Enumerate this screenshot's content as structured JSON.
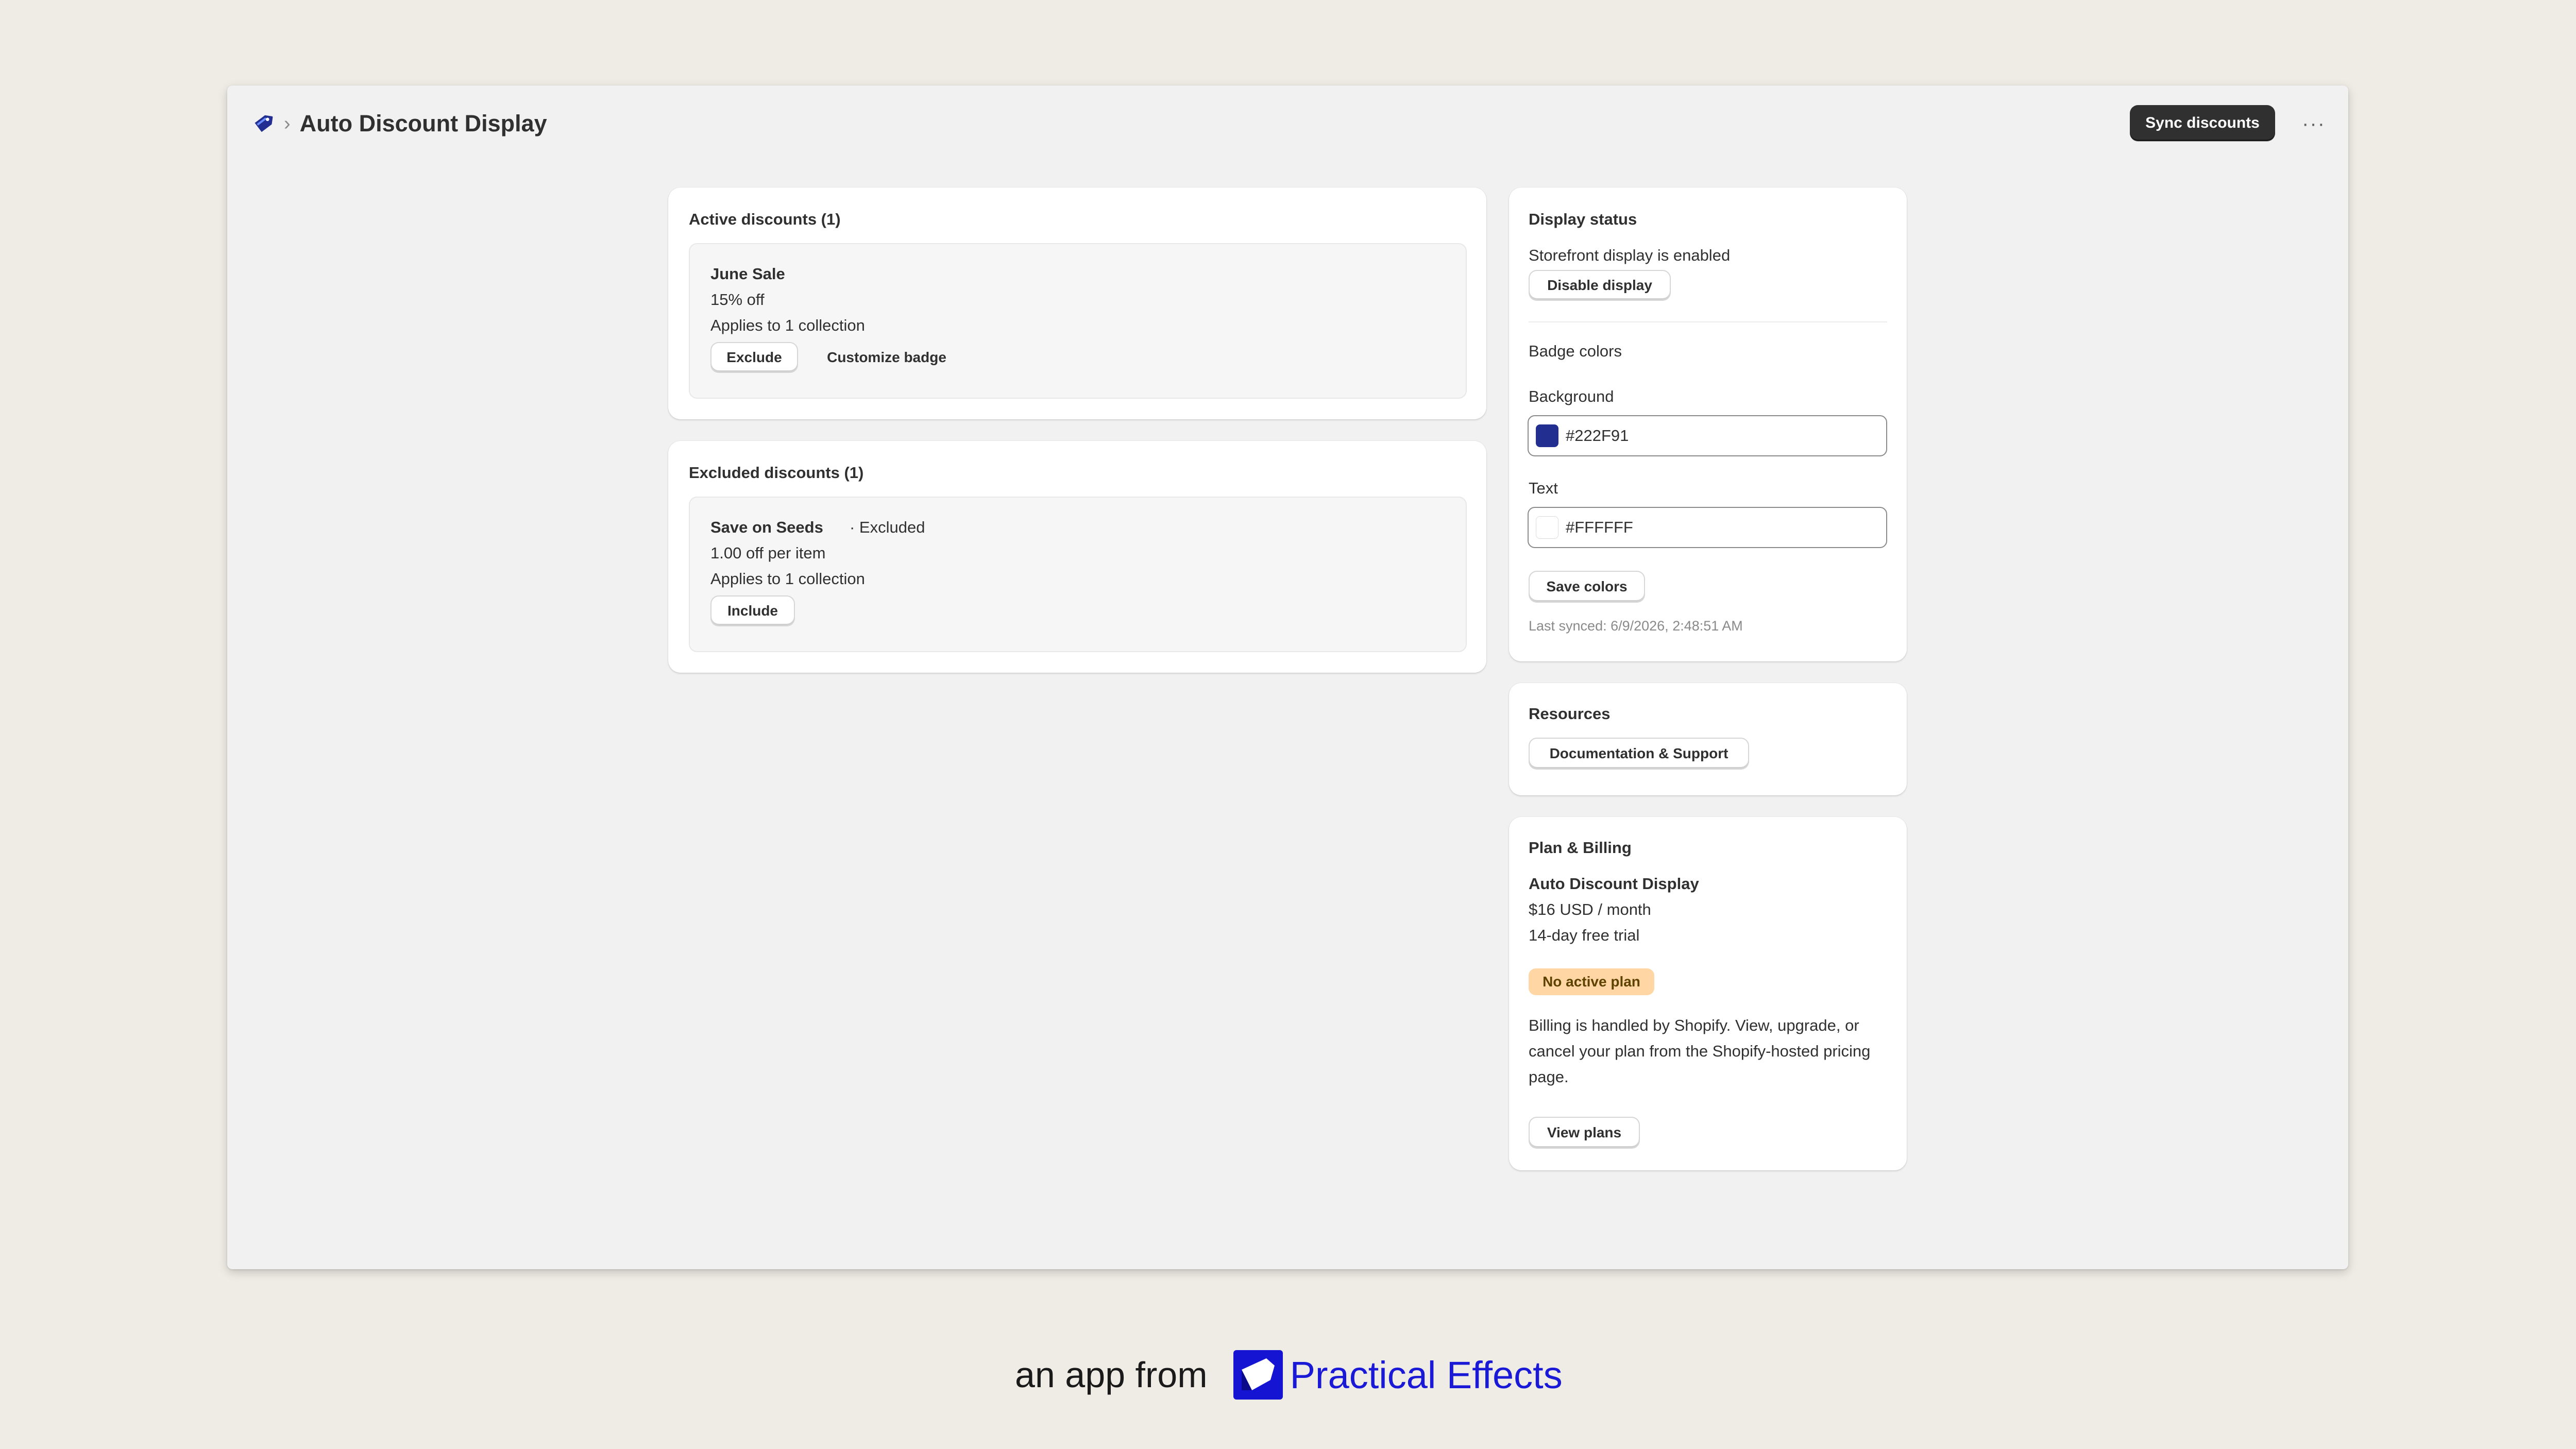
{
  "header": {
    "app_icon": "tag-icon",
    "title": "Auto Discount Display",
    "sync_label": "Sync discounts",
    "more_icon": "more-horizontal-icon"
  },
  "active_discounts": {
    "title": "Active discounts (1)",
    "items": [
      {
        "name": "June Sale",
        "value": "15% off",
        "applies": "Applies to 1 collection",
        "exclude_label": "Exclude",
        "customize_label": "Customize badge"
      }
    ]
  },
  "excluded_discounts": {
    "title": "Excluded discounts (1)",
    "items": [
      {
        "name": "Save on Seeds",
        "status": "· Excluded",
        "value": "1.00 off per item",
        "applies": "Applies to 1 collection",
        "include_label": "Include"
      }
    ]
  },
  "display_status": {
    "title": "Display status",
    "status_text": "Storefront display is enabled",
    "disable_label": "Disable display",
    "badge_colors_title": "Badge colors",
    "background_label": "Background",
    "background_value": "#222F91",
    "text_label": "Text",
    "text_value": "#FFFFFF",
    "save_label": "Save colors",
    "last_synced": "Last synced: 6/9/2026, 2:48:51 AM"
  },
  "resources": {
    "title": "Resources",
    "docs_label": "Documentation & Support"
  },
  "plan_billing": {
    "title": "Plan & Billing",
    "plan_name": "Auto Discount Display",
    "price": "$16 USD / month",
    "trial": "14-day free trial",
    "badge": "No active plan",
    "description": "Billing is handled by Shopify. View, upgrade, or cancel your plan from the Shopify-hosted pricing page.",
    "view_plans_label": "View plans"
  },
  "footer": {
    "prefix": "an app from",
    "brand": "Practical Effects",
    "brand_color": "#1a1ad6"
  },
  "colors": {
    "page_bg": "#efebe5",
    "primary_button": "#303030",
    "accent": "#222F91",
    "badge_warning": "#ffd6a4"
  }
}
